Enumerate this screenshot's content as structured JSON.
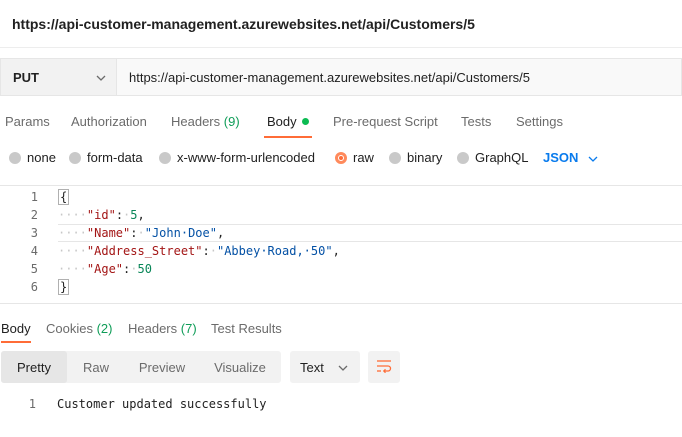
{
  "page": {
    "title": "https://api-customer-management.azurewebsites.net/api/Customers/5"
  },
  "request": {
    "method": "PUT",
    "url": "https://api-customer-management.azurewebsites.net/api/Customers/5"
  },
  "request_tabs": {
    "params": "Params",
    "authorization": "Authorization",
    "headers": "Headers",
    "headers_count": "(9)",
    "body": "Body",
    "pre_request": "Pre-request Script",
    "tests": "Tests",
    "settings": "Settings"
  },
  "body_types": {
    "none": "none",
    "form_data": "form-data",
    "urlencoded": "x-www-form-urlencoded",
    "raw": "raw",
    "binary": "binary",
    "graphql": "GraphQL",
    "format": "JSON",
    "selected": "raw"
  },
  "editor": {
    "line_numbers": [
      "1",
      "2",
      "3",
      "4",
      "5",
      "6"
    ],
    "open_brace": "{",
    "close_brace": "}",
    "indent": "····",
    "fields": [
      {
        "key": "\"id\"",
        "value": "5",
        "type": "number",
        "comma": ","
      },
      {
        "key": "\"Name\"",
        "value": "\"John·Doe\"",
        "type": "string",
        "comma": ","
      },
      {
        "key": "\"Address_Street\"",
        "value": "\"Abbey·Road,·50\"",
        "type": "string",
        "comma": ","
      },
      {
        "key": "\"Age\"",
        "value": "50",
        "type": "number",
        "comma": ""
      }
    ],
    "colon": ":",
    "space": "·"
  },
  "response_tabs": {
    "body": "Body",
    "cookies": "Cookies",
    "cookies_count": "(2)",
    "headers": "Headers",
    "headers_count": "(7)",
    "test_results": "Test Results"
  },
  "response_toolbar": {
    "views": [
      "Pretty",
      "Raw",
      "Preview",
      "Visualize"
    ],
    "selected_view": "Pretty",
    "format": "Text"
  },
  "response_body": {
    "line_number": "1",
    "text": "Customer updated successfully"
  },
  "colors": {
    "accent": "#ff6c37",
    "count_green": "#0f9d58",
    "link_blue": "#097bed"
  }
}
